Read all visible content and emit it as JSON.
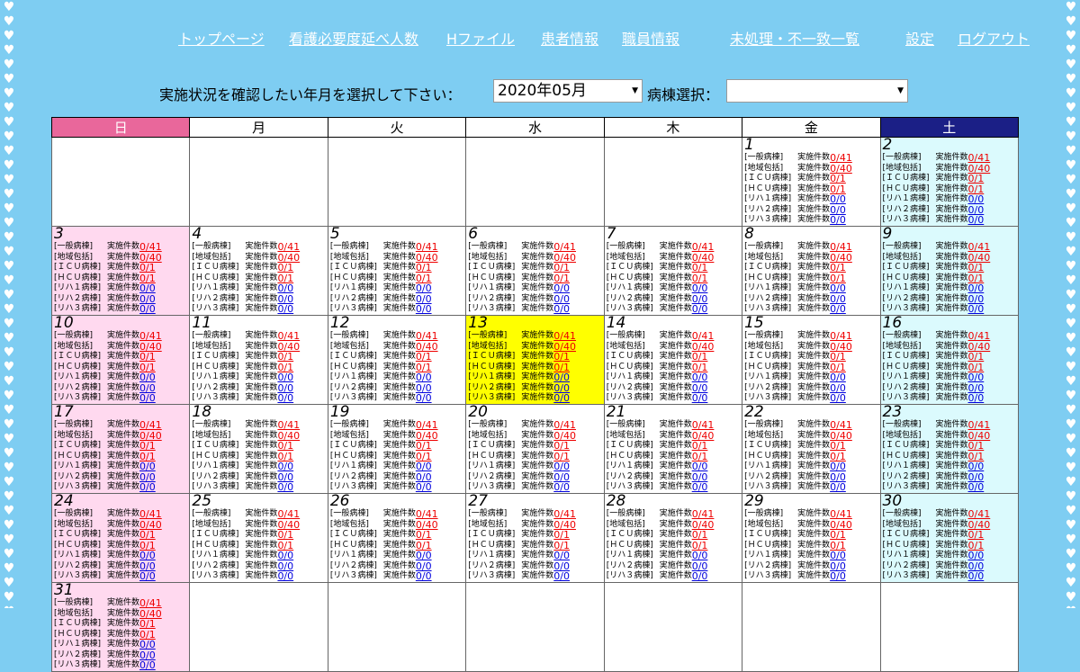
{
  "nav": [
    {
      "label": "トップページ",
      "name": "nav-top-page"
    },
    {
      "label": "看護必要度延べ人数",
      "name": "nav-nursing-count"
    },
    {
      "label": "Hファイル",
      "name": "nav-h-file"
    },
    {
      "label": "患者情報",
      "name": "nav-patient-info"
    },
    {
      "label": "職員情報",
      "name": "nav-staff-info"
    },
    {
      "label": "未処理・不一致一覧",
      "name": "nav-unprocessed-list"
    },
    {
      "label": "設定",
      "name": "nav-settings"
    },
    {
      "label": "ログアウト",
      "name": "nav-logout"
    }
  ],
  "selector": {
    "prompt": "実施状況を確認したい年月を選択して下さい：",
    "month_value": "2020年05月",
    "ward_label": "病棟選択：",
    "ward_value": ""
  },
  "weekdays": [
    "日",
    "月",
    "火",
    "水",
    "木",
    "金",
    "土"
  ],
  "entry_label": "実施件数",
  "wards": [
    {
      "name": "[一般病棟]",
      "count": "0/41",
      "color": "r"
    },
    {
      "name": "[地域包括]",
      "count": "0/40",
      "color": "r"
    },
    {
      "name": "[ＩＣＵ病棟]",
      "count": "0/1",
      "color": "r"
    },
    {
      "name": "[ＨＣＵ病棟]",
      "count": "0/1",
      "color": "r"
    },
    {
      "name": "[リハ１病棟]",
      "count": "0/0",
      "color": "b"
    },
    {
      "name": "[リハ２病棟]",
      "count": "0/0",
      "color": "b"
    },
    {
      "name": "[リハ３病棟]",
      "count": "0/0",
      "color": "b"
    }
  ],
  "calendar": {
    "first_weekday": 5,
    "days": 31,
    "today": 13
  }
}
